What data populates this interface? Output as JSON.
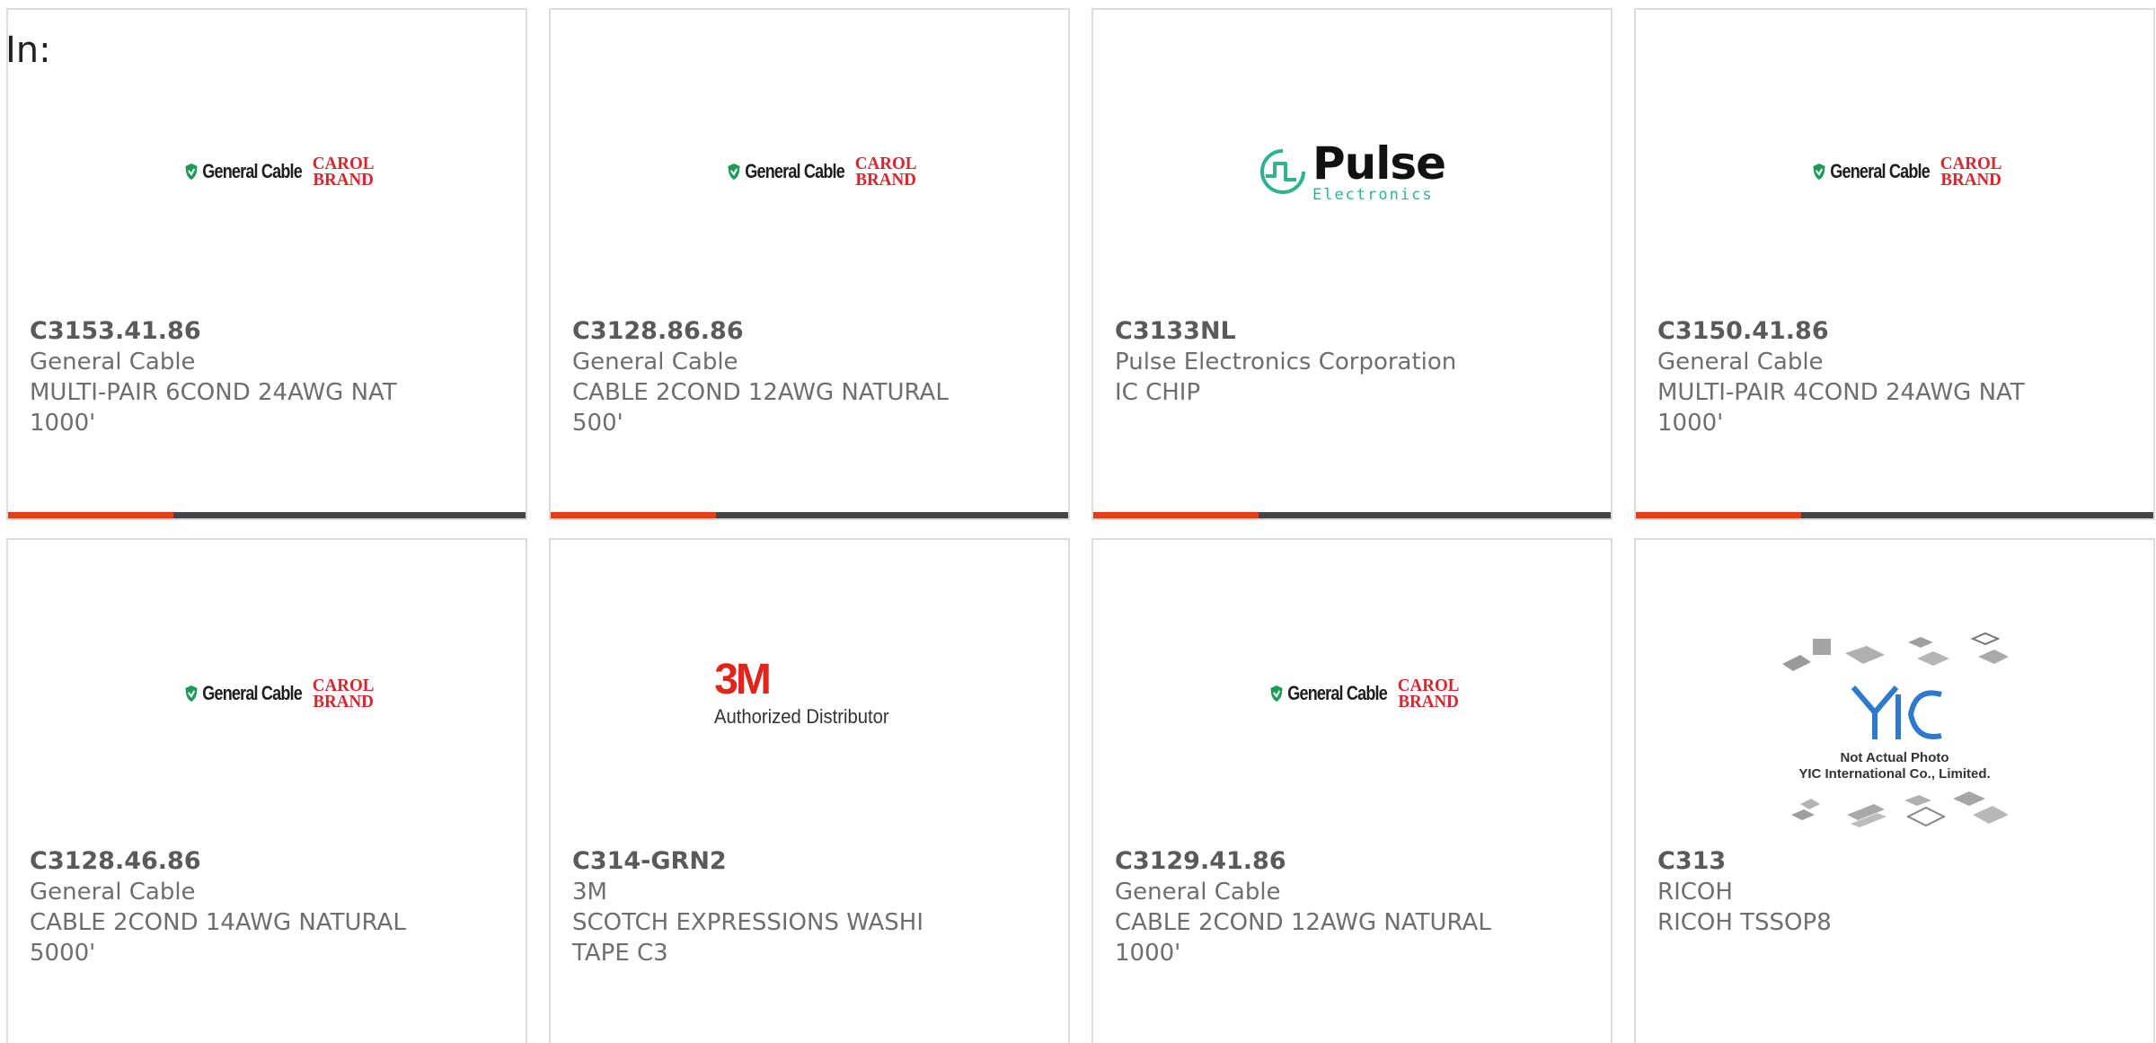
{
  "page": {
    "label": "In:"
  },
  "colors": {
    "progress_fill": "#ee3b10",
    "progress_track": "#444444",
    "gc_brand_red": "#d7262d",
    "gc_shield_green": "#1f9a57",
    "pulse_teal": "#2fb38f",
    "m3_red": "#e1251b",
    "yic_blue": "#2e79c9"
  },
  "logos": {
    "general_cable": {
      "name": "General Cable",
      "brand_line1": "CAROL",
      "brand_line2": "BRAND"
    },
    "pulse": {
      "name": "Pulse",
      "sub": "Electronics"
    },
    "m3": {
      "name": "3M",
      "sub": "Authorized Distributor"
    },
    "yic": {
      "line1": "Not Actual Photo",
      "line2": "YIC International Co., Limited."
    }
  },
  "products": [
    {
      "part_number": "C3153.41.86",
      "manufacturer": "General Cable",
      "description": "MULTI-PAIR 6COND 24AWG NAT 1000'",
      "logo": "general_cable",
      "progress": 0.32
    },
    {
      "part_number": "C3128.86.86",
      "manufacturer": "General Cable",
      "description": "CABLE 2COND 12AWG NATURAL 500'",
      "logo": "general_cable",
      "progress": 0.32
    },
    {
      "part_number": "C3133NL",
      "manufacturer": "Pulse Electronics Corporation",
      "description": "IC CHIP",
      "logo": "pulse",
      "progress": 0.32
    },
    {
      "part_number": "C3150.41.86",
      "manufacturer": "General Cable",
      "description": "MULTI-PAIR 4COND 24AWG NAT 1000'",
      "logo": "general_cable",
      "progress": 0.32
    },
    {
      "part_number": "C3128.46.86",
      "manufacturer": "General Cable",
      "description": "CABLE 2COND 14AWG NATURAL 5000'",
      "logo": "general_cable"
    },
    {
      "part_number": "C314-GRN2",
      "manufacturer": "3M",
      "description": "SCOTCH EXPRESSIONS WASHI TAPE C3",
      "logo": "m3"
    },
    {
      "part_number": "C3129.41.86",
      "manufacturer": "General Cable",
      "description": "CABLE 2COND 12AWG NATURAL 1000'",
      "logo": "general_cable"
    },
    {
      "part_number": "C313",
      "manufacturer": "RICOH",
      "description": "RICOH TSSOP8",
      "logo": "yic"
    }
  ]
}
